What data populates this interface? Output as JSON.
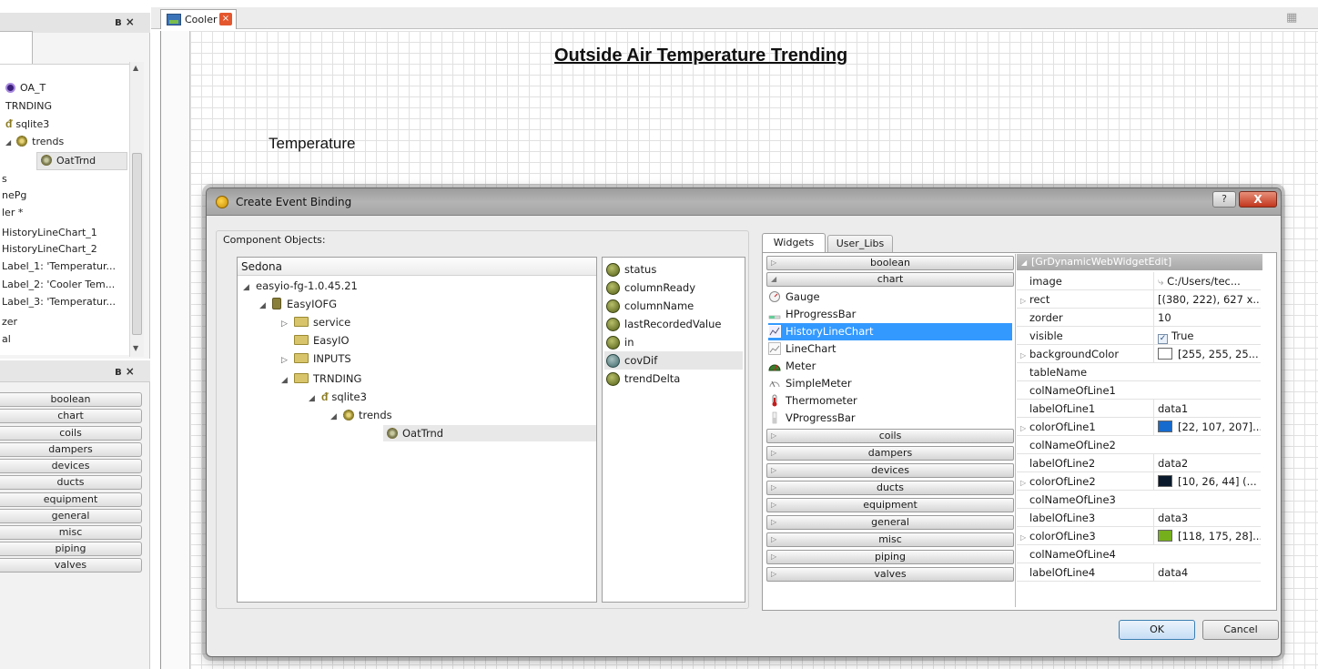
{
  "left_panel_top": {
    "controls": "ʙ ×",
    "items": [
      {
        "icon": "purple-point-icon",
        "label": "OA_T"
      },
      {
        "icon": "none",
        "label": "TRNDING"
      },
      {
        "icon": "link-icon",
        "label": "sqlite3"
      },
      {
        "icon": "gear-icon",
        "label": "trends"
      },
      {
        "icon": "gear-icon",
        "label": "OatTrnd"
      },
      {
        "icon": "none",
        "label": "s"
      },
      {
        "icon": "none",
        "label": "nePg"
      },
      {
        "icon": "none",
        "label": "ler *"
      },
      {
        "icon": "none",
        "label": "HistoryLineChart_1"
      },
      {
        "icon": "none",
        "label": "HistoryLineChart_2"
      },
      {
        "icon": "none",
        "label": "Label_1: 'Temperatur..."
      },
      {
        "icon": "none",
        "label": "Label_2: 'Cooler Tem..."
      },
      {
        "icon": "none",
        "label": "Label_3: 'Temperatur..."
      },
      {
        "icon": "none",
        "label": "zer"
      },
      {
        "icon": "none",
        "label": "al"
      }
    ]
  },
  "left_panel_bottom": {
    "controls": "ʙ ×",
    "categories": [
      "boolean",
      "chart",
      "coils",
      "dampers",
      "devices",
      "ducts",
      "equipment",
      "general",
      "misc",
      "piping",
      "valves"
    ]
  },
  "tabbar": {
    "tab_label": "Cooler",
    "close_glyph": "×",
    "right_glyph": "▦"
  },
  "canvas": {
    "title": "Outside Air Temperature Trending",
    "temperature_label": "Temperature"
  },
  "dialog": {
    "title": "Create Event Binding",
    "help_glyph": "?",
    "close_glyph": "X",
    "component_objects_label": "Component Objects:",
    "tree_header": "Sedona",
    "tree": [
      {
        "exp": "◢",
        "icon": "none",
        "label": "easyio-fg-1.0.45.21"
      },
      {
        "exp": "◢",
        "icon": "db",
        "label": "EasyIOFG"
      },
      {
        "exp": "▷",
        "icon": "folder",
        "label": "service"
      },
      {
        "exp": "",
        "icon": "folder",
        "label": "EasyIO"
      },
      {
        "exp": "▷",
        "icon": "folder",
        "label": "INPUTS"
      },
      {
        "exp": "◢",
        "icon": "folder",
        "label": "TRNDING"
      },
      {
        "exp": "◢",
        "icon": "link",
        "label": "sqlite3"
      },
      {
        "exp": "◢",
        "icon": "gear",
        "label": "trends"
      },
      {
        "exp": "",
        "icon": "gear-small",
        "label": "OatTrnd"
      }
    ],
    "slots": [
      "status",
      "columnReady",
      "columnName",
      "lastRecordedValue",
      "in",
      "covDif",
      "trendDelta"
    ],
    "tabs": {
      "widgets": "Widgets",
      "user_libs": "User_Libs"
    },
    "widget_categories_top": [
      "boolean",
      "chart"
    ],
    "chart_widgets": [
      {
        "icon": "gauge-icon",
        "label": "Gauge"
      },
      {
        "icon": "hprogressbar-icon",
        "label": "HProgressBar"
      },
      {
        "icon": "history-line-chart-icon",
        "label": "HistoryLineChart"
      },
      {
        "icon": "line-chart-icon",
        "label": "LineChart"
      },
      {
        "icon": "meter-icon",
        "label": "Meter"
      },
      {
        "icon": "simple-meter-icon",
        "label": "SimpleMeter"
      },
      {
        "icon": "thermometer-icon",
        "label": "Thermometer"
      },
      {
        "icon": "vprogressbar-icon",
        "label": "VProgressBar"
      }
    ],
    "widget_categories_bottom": [
      "coils",
      "dampers",
      "devices",
      "ducts",
      "equipment",
      "general",
      "misc",
      "piping",
      "valves"
    ],
    "properties_header": "[GrDynamicWebWidgetEdit]",
    "properties": [
      {
        "key": "image",
        "value": "C:/Users/tec...",
        "expand": false,
        "swatch": "",
        "check": false
      },
      {
        "key": "rect",
        "value": "[(380, 222), 627 x...",
        "expand": true,
        "swatch": "",
        "check": false
      },
      {
        "key": "zorder",
        "value": "10",
        "expand": false,
        "swatch": "",
        "check": false
      },
      {
        "key": "visible",
        "value": "True",
        "expand": false,
        "swatch": "",
        "check": true
      },
      {
        "key": "backgroundColor",
        "value": "[255, 255, 25...",
        "expand": true,
        "swatch": "#ffffff",
        "check": false
      },
      {
        "key": "tableName",
        "value": "",
        "expand": false,
        "swatch": "",
        "check": false
      },
      {
        "key": "colNameOfLine1",
        "value": "",
        "expand": false,
        "swatch": "",
        "check": false
      },
      {
        "key": "labelOfLine1",
        "value": "data1",
        "expand": false,
        "swatch": "",
        "check": false
      },
      {
        "key": "colorOfLine1",
        "value": "[22, 107, 207]...",
        "expand": true,
        "swatch": "#166bcf",
        "check": false
      },
      {
        "key": "colNameOfLine2",
        "value": "",
        "expand": false,
        "swatch": "",
        "check": false
      },
      {
        "key": "labelOfLine2",
        "value": "data2",
        "expand": false,
        "swatch": "",
        "check": false
      },
      {
        "key": "colorOfLine2",
        "value": "[10, 26, 44] (...",
        "expand": true,
        "swatch": "#0a1a2c",
        "check": false
      },
      {
        "key": "colNameOfLine3",
        "value": "",
        "expand": false,
        "swatch": "",
        "check": false
      },
      {
        "key": "labelOfLine3",
        "value": "data3",
        "expand": false,
        "swatch": "",
        "check": false
      },
      {
        "key": "colorOfLine3",
        "value": "[118, 175, 28]...",
        "expand": true,
        "swatch": "#76af1c",
        "check": false
      },
      {
        "key": "colNameOfLine4",
        "value": "",
        "expand": false,
        "swatch": "",
        "check": false
      },
      {
        "key": "labelOfLine4",
        "value": "data4",
        "expand": false,
        "swatch": "",
        "check": false
      }
    ],
    "ok_label": "OK",
    "cancel_label": "Cancel"
  },
  "colors": {
    "selection": "#3399ff",
    "dialog_close": "#c2361d",
    "tab_close": "#e4572e"
  }
}
